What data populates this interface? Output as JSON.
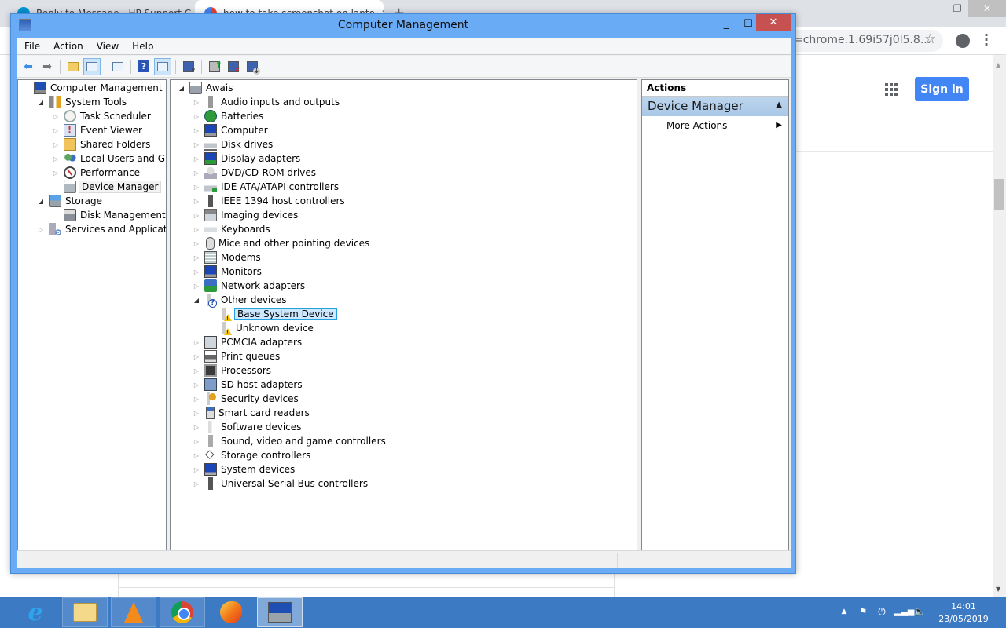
{
  "browser": {
    "tabs": [
      {
        "label": "Reply to Message - HP Support C",
        "favicon": "hp-icon",
        "active": false
      },
      {
        "label": "how to take screenshot on lapto",
        "favicon": "google-icon",
        "active": true
      }
    ],
    "new_tab_symbol": "+",
    "window_controls": {
      "minimize": "–",
      "restore": "❐",
      "close": "✕"
    },
    "address_text": "=chrome.1.69i57j0l5.8...",
    "star_symbol": "☆",
    "menu_symbol": "⋮",
    "sign_in_label": "Sign in",
    "scroll_up": "▲",
    "scroll_down": "▼"
  },
  "window": {
    "title": "Computer Management",
    "controls": {
      "minimize": "_",
      "maximize": "☐",
      "close": "✕"
    },
    "menu": [
      "File",
      "Action",
      "View",
      "Help"
    ],
    "toolbar": [
      {
        "name": "back",
        "icon": "back-arrow-icon",
        "glyph": "⬅"
      },
      {
        "name": "forward",
        "icon": "forward-arrow-icon",
        "glyph": "➡"
      },
      {
        "name": "up-one-level",
        "icon": "folder-up-icon"
      },
      {
        "name": "show-hide-console-tree",
        "icon": "console-tree-icon",
        "pressed": true
      },
      {
        "name": "properties",
        "icon": "properties-icon"
      },
      {
        "name": "help",
        "icon": "help-icon",
        "glyph": "?"
      },
      {
        "name": "show-hide-action-pane",
        "icon": "action-pane-icon",
        "pressed": true
      },
      {
        "name": "scan-hardware",
        "icon": "scan-hardware-icon"
      },
      {
        "name": "update-driver",
        "icon": "update-driver-icon"
      },
      {
        "name": "uninstall-device",
        "icon": "uninstall-device-icon"
      },
      {
        "name": "disable-device",
        "icon": "disable-device-icon"
      }
    ]
  },
  "console_tree": {
    "items": [
      {
        "label": "Computer Management (Local)",
        "level": 0,
        "toggle": "",
        "icon": "computer-management-icon",
        "icon_class": "ic-computer"
      },
      {
        "label": "System Tools",
        "level": 1,
        "toggle": "◢",
        "expanded": true,
        "icon": "tools-icon",
        "icon_class": "ic-tools"
      },
      {
        "label": "Task Scheduler",
        "level": 2,
        "toggle": "▷",
        "icon": "clock-icon",
        "icon_class": "ic-clock"
      },
      {
        "label": "Event Viewer",
        "level": 2,
        "toggle": "▷",
        "icon": "event-viewer-icon",
        "icon_class": "ic-event"
      },
      {
        "label": "Shared Folders",
        "level": 2,
        "toggle": "▷",
        "icon": "shared-folders-icon",
        "icon_class": "ic-share"
      },
      {
        "label": "Local Users and Groups",
        "level": 2,
        "toggle": "▷",
        "icon": "users-icon",
        "icon_class": "ic-users"
      },
      {
        "label": "Performance",
        "level": 2,
        "toggle": "▷",
        "icon": "performance-icon",
        "icon_class": "ic-perf"
      },
      {
        "label": "Device Manager",
        "level": 2,
        "toggle": "",
        "icon": "device-manager-icon",
        "icon_class": "ic-devmgr",
        "selected": true
      },
      {
        "label": "Storage",
        "level": 1,
        "toggle": "◢",
        "expanded": true,
        "icon": "storage-icon",
        "icon_class": "ic-storage"
      },
      {
        "label": "Disk Management",
        "level": 2,
        "toggle": "",
        "icon": "disk-management-icon",
        "icon_class": "ic-disk"
      },
      {
        "label": "Services and Applications",
        "level": 1,
        "toggle": "▷",
        "icon": "services-icon",
        "icon_class": "ic-services"
      }
    ],
    "scroll_left": "‹",
    "scroll_right": "›"
  },
  "device_tree": {
    "root": {
      "label": "Awais",
      "toggle": "◢",
      "icon": "computer-icon",
      "icon_class": "ic-awais"
    },
    "items": [
      {
        "label": "Audio inputs and outputs",
        "level": 1,
        "toggle": "▷",
        "icon": "speaker-icon",
        "icon_class": "ic-audio"
      },
      {
        "label": "Batteries",
        "level": 1,
        "toggle": "▷",
        "icon": "battery-icon",
        "icon_class": "ic-battery"
      },
      {
        "label": "Computer",
        "level": 1,
        "toggle": "▷",
        "icon": "computer-icon",
        "icon_class": "ic-monitor"
      },
      {
        "label": "Disk drives",
        "level": 1,
        "toggle": "▷",
        "icon": "disk-drive-icon",
        "icon_class": "ic-drive"
      },
      {
        "label": "Display adapters",
        "level": 1,
        "toggle": "▷",
        "icon": "display-adapter-icon",
        "icon_class": "ic-display"
      },
      {
        "label": "DVD/CD-ROM drives",
        "level": 1,
        "toggle": "▷",
        "icon": "dvd-drive-icon",
        "icon_class": "ic-dvd"
      },
      {
        "label": "IDE ATA/ATAPI controllers",
        "level": 1,
        "toggle": "▷",
        "icon": "ide-controller-icon",
        "icon_class": "ic-ide"
      },
      {
        "label": "IEEE 1394 host controllers",
        "level": 1,
        "toggle": "▷",
        "icon": "ieee1394-icon",
        "icon_class": "ic-usb"
      },
      {
        "label": "Imaging devices",
        "level": 1,
        "toggle": "▷",
        "icon": "camera-icon",
        "icon_class": "ic-imaging"
      },
      {
        "label": "Keyboards",
        "level": 1,
        "toggle": "▷",
        "icon": "keyboard-icon",
        "icon_class": "ic-keyboard"
      },
      {
        "label": "Mice and other pointing devices",
        "level": 1,
        "toggle": "▷",
        "icon": "mouse-icon",
        "icon_class": "ic-mouse"
      },
      {
        "label": "Modems",
        "level": 1,
        "toggle": "▷",
        "icon": "modem-icon",
        "icon_class": "ic-modem"
      },
      {
        "label": "Monitors",
        "level": 1,
        "toggle": "▷",
        "icon": "monitor-icon",
        "icon_class": "ic-monitor"
      },
      {
        "label": "Network adapters",
        "level": 1,
        "toggle": "▷",
        "icon": "network-adapter-icon",
        "icon_class": "ic-network"
      },
      {
        "label": "Other devices",
        "level": 1,
        "toggle": "◢",
        "expanded": true,
        "icon": "unknown-device-icon",
        "icon_class": "ic-other"
      },
      {
        "label": "Base System Device",
        "level": 2,
        "toggle": "",
        "icon": "warning-device-icon",
        "icon_class": "ic-warn",
        "selected": true
      },
      {
        "label": "Unknown device",
        "level": 2,
        "toggle": "",
        "icon": "warning-device-icon",
        "icon_class": "ic-warn"
      },
      {
        "label": "PCMCIA adapters",
        "level": 1,
        "toggle": "▷",
        "icon": "pcmcia-icon",
        "icon_class": "ic-pcmcia"
      },
      {
        "label": "Print queues",
        "level": 1,
        "toggle": "▷",
        "icon": "printer-icon",
        "icon_class": "ic-print"
      },
      {
        "label": "Processors",
        "level": 1,
        "toggle": "▷",
        "icon": "processor-icon",
        "icon_class": "ic-cpu"
      },
      {
        "label": "SD host adapters",
        "level": 1,
        "toggle": "▷",
        "icon": "sd-card-icon",
        "icon_class": "ic-sd"
      },
      {
        "label": "Security devices",
        "level": 1,
        "toggle": "▷",
        "icon": "key-icon",
        "icon_class": "ic-security"
      },
      {
        "label": "Smart card readers",
        "level": 1,
        "toggle": "▷",
        "icon": "smart-card-icon",
        "icon_class": "ic-smartcard"
      },
      {
        "label": "Software devices",
        "level": 1,
        "toggle": "▷",
        "icon": "software-device-icon",
        "icon_class": "ic-software"
      },
      {
        "label": "Sound, video and game controllers",
        "level": 1,
        "toggle": "▷",
        "icon": "speaker-icon",
        "icon_class": "ic-sound"
      },
      {
        "label": "Storage controllers",
        "level": 1,
        "toggle": "▷",
        "icon": "storage-controller-icon",
        "icon_class": "ic-storagectl"
      },
      {
        "label": "System devices",
        "level": 1,
        "toggle": "▷",
        "icon": "system-device-icon",
        "icon_class": "ic-sysdev"
      },
      {
        "label": "Universal Serial Bus controllers",
        "level": 1,
        "toggle": "▷",
        "icon": "usb-icon",
        "icon_class": "ic-usb"
      }
    ]
  },
  "actions_pane": {
    "header": "Actions",
    "section_title": "Device Manager",
    "section_collapse": "▲",
    "items": [
      {
        "label": "More Actions",
        "arrow": "▶"
      }
    ]
  },
  "taskbar": {
    "apps": [
      {
        "name": "internet-explorer",
        "glyph": "e"
      },
      {
        "name": "file-explorer"
      },
      {
        "name": "vlc"
      },
      {
        "name": "chrome"
      },
      {
        "name": "browser-app"
      },
      {
        "name": "computer-management",
        "active": true
      }
    ],
    "tray": {
      "show_hidden": "▲",
      "time": "14:01",
      "date": "23/05/2019"
    }
  }
}
